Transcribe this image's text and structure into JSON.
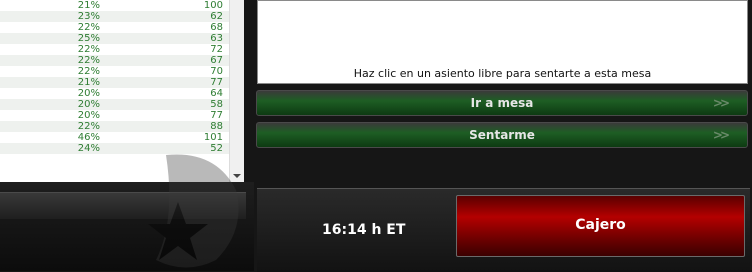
{
  "table": {
    "rows": [
      {
        "pct": "21%",
        "count": "100"
      },
      {
        "pct": "23%",
        "count": "62"
      },
      {
        "pct": "22%",
        "count": "68"
      },
      {
        "pct": "25%",
        "count": "63"
      },
      {
        "pct": "22%",
        "count": "72"
      },
      {
        "pct": "22%",
        "count": "67"
      },
      {
        "pct": "22%",
        "count": "70"
      },
      {
        "pct": "21%",
        "count": "77"
      },
      {
        "pct": "20%",
        "count": "64"
      },
      {
        "pct": "20%",
        "count": "58"
      },
      {
        "pct": "20%",
        "count": "77"
      },
      {
        "pct": "22%",
        "count": "88"
      },
      {
        "pct": "46%",
        "count": "101"
      },
      {
        "pct": "24%",
        "count": "52"
      }
    ]
  },
  "message": "Haz clic en un asiento libre para sentarte a esta mesa",
  "buttons": {
    "ir_a_mesa": "Ir a mesa",
    "sentarme": "Sentarme",
    "arrows": ">>",
    "cajero": "Cajero"
  },
  "clock": "16:14 h ET",
  "colors": {
    "row_text": "#2e7d32",
    "button_green": "#1e5e24",
    "cashier_red": "#b40000"
  },
  "icons": {
    "scroll": "chevron-down-icon",
    "logo": "star-logo-icon",
    "button_arrows": "double-arrow-icon"
  }
}
